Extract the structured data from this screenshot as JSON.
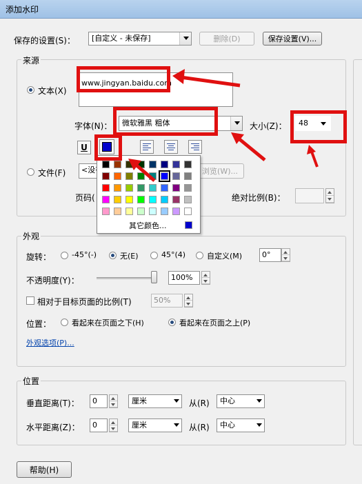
{
  "window": {
    "title": "添加水印"
  },
  "saved_settings": {
    "label": "保存的设置(S)：",
    "value": "[自定义 - 未保存]",
    "delete_label": "删除(D)",
    "save_label": "保存设置(V)..."
  },
  "source": {
    "group_label": "来源",
    "text_radio_label": "文本(X)",
    "text_value": "www.jingyan.baidu.com",
    "font_label": "字体(N)：",
    "font_value": "微软雅黑 粗体",
    "size_label": "大小(Z)：",
    "size_value": "48",
    "underline_label": "U",
    "file_radio_label": "文件(F)",
    "file_value": "<没有",
    "browse_label": "浏览(W)...",
    "page_label": "页码(",
    "abs_scale_label": "绝对比例(B)："
  },
  "palette": {
    "more_colors_label": "其它颜色...",
    "selected_color": "#0000cc",
    "colors": [
      "#000000",
      "#993300",
      "#333300",
      "#003300",
      "#003366",
      "#000080",
      "#333399",
      "#333333",
      "#800000",
      "#ff6600",
      "#808000",
      "#008000",
      "#008080",
      "#0000ff",
      "#666699",
      "#808080",
      "#ff0000",
      "#ff9900",
      "#99cc00",
      "#339966",
      "#33cccc",
      "#3366ff",
      "#800080",
      "#969696",
      "#ff00ff",
      "#ffcc00",
      "#ffff00",
      "#00ff00",
      "#00ffff",
      "#00ccff",
      "#993366",
      "#c0c0c0",
      "#ff99cc",
      "#ffcc99",
      "#ffff99",
      "#ccffcc",
      "#ccffff",
      "#99ccff",
      "#cc99ff",
      "#ffffff"
    ]
  },
  "appearance": {
    "group_label": "外观",
    "rotate_label": "旋转：",
    "rot_neg45": "-45°(-)",
    "rot_none": "无(E)",
    "rot_pos45": "45°(4)",
    "rot_custom": "自定义(M)",
    "rot_value": "0°",
    "opacity_label": "不透明度(Y)：",
    "opacity_value": "100%",
    "opacity_level": 1.0,
    "relative_scale_label": "相对于目标页面的比例(T)",
    "relative_scale_value": "50%",
    "position_label": "位置：",
    "behind_label": "看起来在页面之下(H)",
    "above_label": "看起来在页面之上(P)",
    "options_link": "外观选项(P)..."
  },
  "position": {
    "group_label": "位置",
    "vertical_label": "垂直距离(T)：",
    "vertical_value": "0",
    "vertical_unit": "厘米",
    "from_label": "从(R)",
    "vertical_from": "中心",
    "horizontal_label": "水平距离(Z)：",
    "horizontal_value": "0",
    "horizontal_unit": "厘米",
    "horizontal_from": "中心"
  },
  "help_label": "帮助(H)",
  "colors": {
    "annotation_red": "#e01010",
    "accent_blue": "#0000cc"
  }
}
